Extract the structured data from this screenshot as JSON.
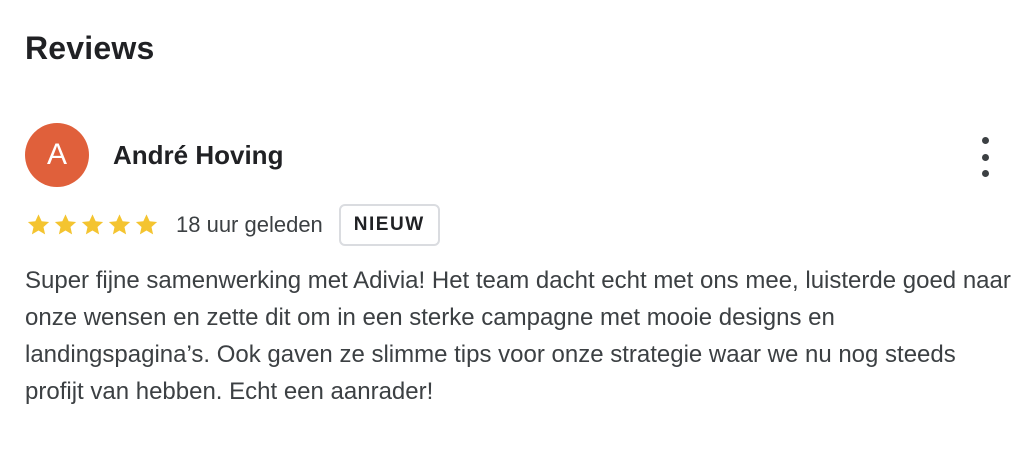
{
  "section": {
    "title": "Reviews"
  },
  "review": {
    "avatar_initial": "A",
    "avatar_color": "#e0603b",
    "author": "André Hoving",
    "rating": 5,
    "rating_max": 5,
    "star_color": "#f4c430",
    "time_ago": "18 uur geleden",
    "badge": "NIEUW",
    "text": "Super fijne samenwerking met Adivia! Het team dacht echt met ons mee, luisterde goed naar onze wensen en zette dit om in een sterke campagne met mooie designs en landingspagina’s. Ook gaven ze slimme tips voor onze strategie waar we nu nog steeds profijt van hebben. Echt een aanrader!",
    "more_icon": "more-vert-icon"
  }
}
